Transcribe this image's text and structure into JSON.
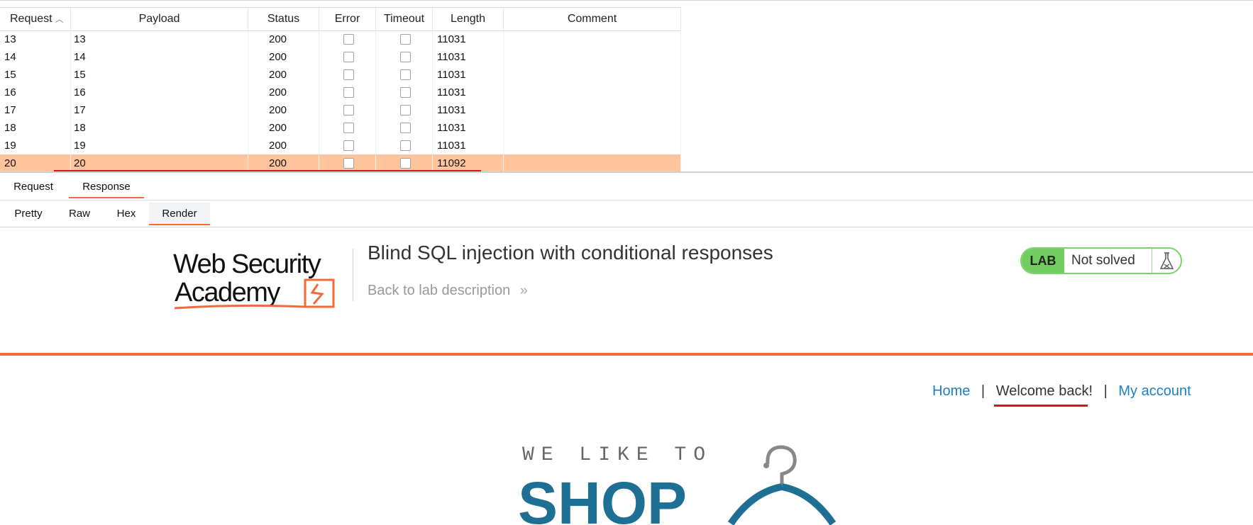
{
  "results": {
    "columns": [
      "Request",
      "Payload",
      "Status",
      "Error",
      "Timeout",
      "Length",
      "Comment"
    ],
    "sort_column": "Request",
    "rows": [
      {
        "request": "13",
        "payload": "13",
        "status": "200",
        "length": "11031"
      },
      {
        "request": "14",
        "payload": "14",
        "status": "200",
        "length": "11031"
      },
      {
        "request": "15",
        "payload": "15",
        "status": "200",
        "length": "11031"
      },
      {
        "request": "16",
        "payload": "16",
        "status": "200",
        "length": "11031"
      },
      {
        "request": "17",
        "payload": "17",
        "status": "200",
        "length": "11031"
      },
      {
        "request": "18",
        "payload": "18",
        "status": "200",
        "length": "11031"
      },
      {
        "request": "19",
        "payload": "19",
        "status": "200",
        "length": "11031"
      },
      {
        "request": "20",
        "payload": "20",
        "status": "200",
        "length": "11092"
      }
    ],
    "selected_row_color": "#ffc49c"
  },
  "message_tabs": [
    "Request",
    "Response"
  ],
  "active_message_tab": "Response",
  "view_tabs": [
    "Pretty",
    "Raw",
    "Hex",
    "Render"
  ],
  "active_view_tab": "Render",
  "render": {
    "logo_line1": "Web Security",
    "logo_line2": "Academy",
    "title": "Blind SQL injection with conditional responses",
    "back_link": "Back to lab description",
    "back_chevrons": "»",
    "lab_label": "LAB",
    "lab_status": "Not solved",
    "nav": {
      "home": "Home",
      "sep": "|",
      "welcome": "Welcome back!",
      "account": "My account"
    },
    "shop_tagline": "WE LIKE TO",
    "shop_word": "SHOP",
    "accent_color": "#f26a3b",
    "link_color": "#1e7fc2"
  }
}
